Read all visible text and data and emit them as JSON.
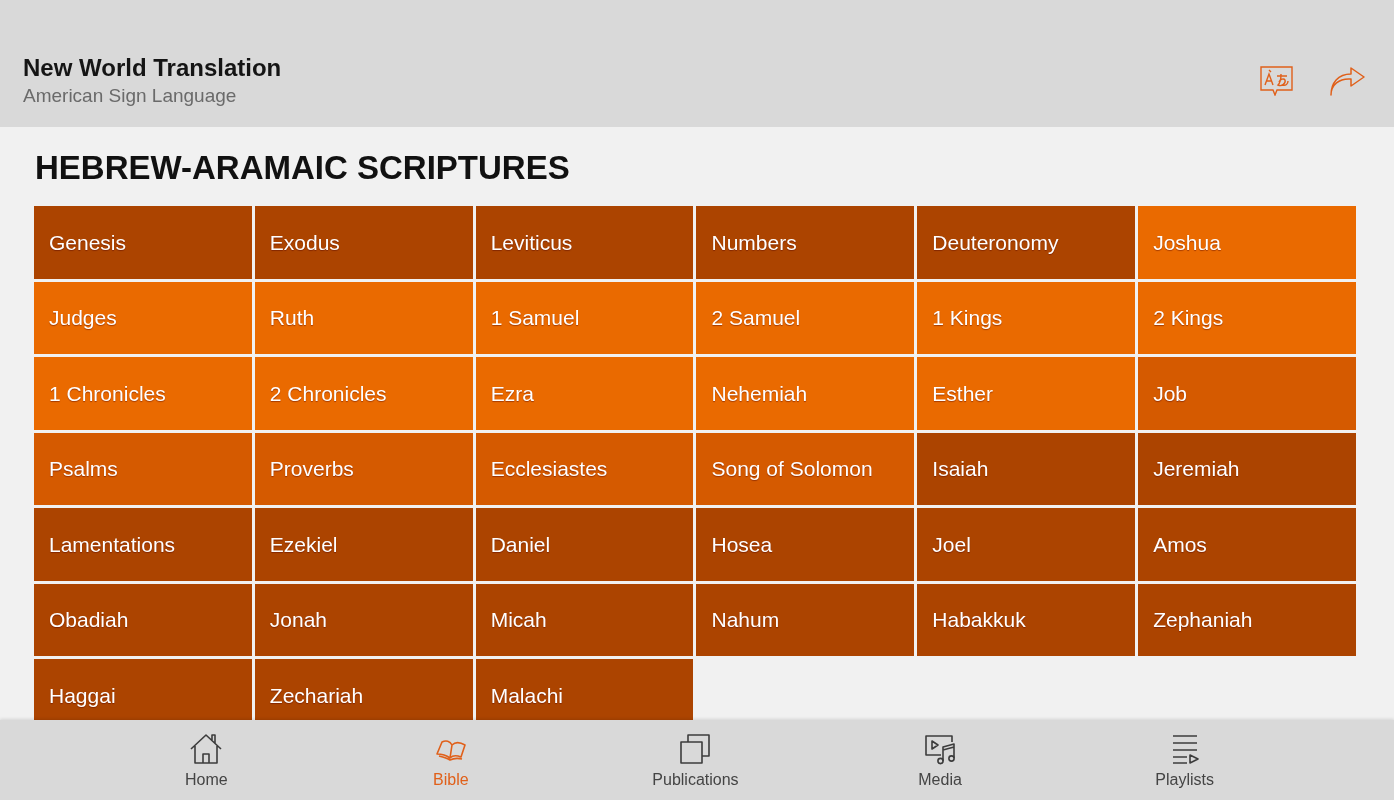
{
  "header": {
    "title": "New World Translation",
    "subtitle": "American Sign Language"
  },
  "section": {
    "title": "HEBREW-ARAMAIC SCRIPTURES",
    "books": [
      {
        "name": "Genesis",
        "color": "#ac4400"
      },
      {
        "name": "Exodus",
        "color": "#ac4400"
      },
      {
        "name": "Leviticus",
        "color": "#ac4400"
      },
      {
        "name": "Numbers",
        "color": "#ac4400"
      },
      {
        "name": "Deuteronomy",
        "color": "#ac4400"
      },
      {
        "name": "Joshua",
        "color": "#ea6a00"
      },
      {
        "name": "Judges",
        "color": "#ea6a00"
      },
      {
        "name": "Ruth",
        "color": "#ea6a00"
      },
      {
        "name": "1 Samuel",
        "color": "#ea6a00"
      },
      {
        "name": "2 Samuel",
        "color": "#ea6a00"
      },
      {
        "name": "1 Kings",
        "color": "#ea6a00"
      },
      {
        "name": "2 Kings",
        "color": "#ea6a00"
      },
      {
        "name": "1 Chronicles",
        "color": "#ea6a00"
      },
      {
        "name": "2 Chronicles",
        "color": "#ea6a00"
      },
      {
        "name": "Ezra",
        "color": "#ea6a00"
      },
      {
        "name": "Nehemiah",
        "color": "#ea6a00"
      },
      {
        "name": "Esther",
        "color": "#ea6a00"
      },
      {
        "name": "Job",
        "color": "#d55a00"
      },
      {
        "name": "Psalms",
        "color": "#d55a00"
      },
      {
        "name": "Proverbs",
        "color": "#d55a00"
      },
      {
        "name": "Ecclesiastes",
        "color": "#d55a00"
      },
      {
        "name": "Song of Solomon",
        "color": "#d55a00"
      },
      {
        "name": "Isaiah",
        "color": "#ac4400"
      },
      {
        "name": "Jeremiah",
        "color": "#ac4400"
      },
      {
        "name": "Lamentations",
        "color": "#ac4400"
      },
      {
        "name": "Ezekiel",
        "color": "#ac4400"
      },
      {
        "name": "Daniel",
        "color": "#ac4400"
      },
      {
        "name": "Hosea",
        "color": "#ac4400"
      },
      {
        "name": "Joel",
        "color": "#ac4400"
      },
      {
        "name": "Amos",
        "color": "#ac4400"
      },
      {
        "name": "Obadiah",
        "color": "#ac4400"
      },
      {
        "name": "Jonah",
        "color": "#ac4400"
      },
      {
        "name": "Micah",
        "color": "#ac4400"
      },
      {
        "name": "Nahum",
        "color": "#ac4400"
      },
      {
        "name": "Habakkuk",
        "color": "#ac4400"
      },
      {
        "name": "Zephaniah",
        "color": "#ac4400"
      },
      {
        "name": "Haggai",
        "color": "#ac4400"
      },
      {
        "name": "Zechariah",
        "color": "#ac4400"
      },
      {
        "name": "Malachi",
        "color": "#ac4400"
      }
    ]
  },
  "nav": [
    {
      "kind": "home",
      "label": "Home",
      "selected": false
    },
    {
      "kind": "bible",
      "label": "Bible",
      "selected": true
    },
    {
      "kind": "publications",
      "label": "Publications",
      "selected": false
    },
    {
      "kind": "media",
      "label": "Media",
      "selected": false
    },
    {
      "kind": "playlists",
      "label": "Playlists",
      "selected": false
    }
  ]
}
